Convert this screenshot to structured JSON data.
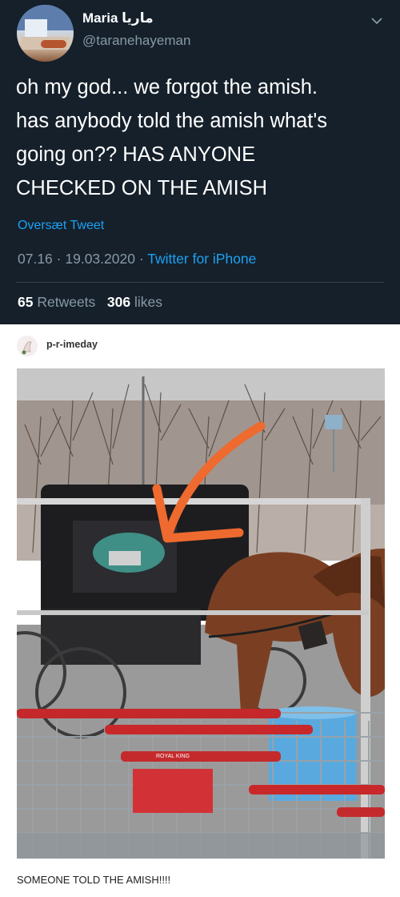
{
  "tweet": {
    "display_name": "Maria ماريا",
    "handle": "@taranehayeman",
    "text": "oh my god...  we forgot the amish.\nhas anybody told the amish what's\ngoing on??  HAS ANYONE\nCHECKED ON THE AMISH",
    "translate_label": "Oversæt Tweet",
    "time": "07.16",
    "date": "19.03.2020",
    "separator": "·",
    "client": "Twitter for iPhone",
    "retweets_count": "65",
    "retweets_label": "Retweets",
    "likes_count": "306",
    "likes_label": "likes",
    "bg_color": "#15202b",
    "link_color": "#1da1f2",
    "muted_color": "#8899a6",
    "menu_icon": "chevron-down-icon"
  },
  "post": {
    "username": "p-r-imeday",
    "caption": "SOMEONE TOLD THE AMISH!!!!",
    "cart_sign": "ROYAL KING"
  }
}
